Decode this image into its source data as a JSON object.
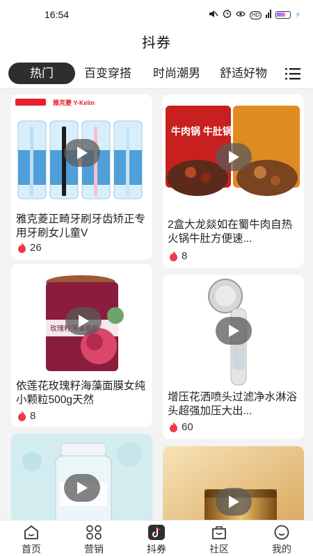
{
  "status_bar": {
    "time": "16:54",
    "icons": [
      "mute-icon",
      "alarm-icon",
      "eye-icon",
      "hd-icon",
      "signal-icon",
      "battery-icon",
      "charging-icon"
    ],
    "hd_text": "HD"
  },
  "header": {
    "title": "抖券"
  },
  "tabs": [
    {
      "label": "热门",
      "active": true
    },
    {
      "label": "百变穿搭"
    },
    {
      "label": "时尚潮男"
    },
    {
      "label": "舒适好物"
    }
  ],
  "products": [
    {
      "title": "雅克菱正畸牙刷牙齿矫正专用牙刷女儿童V",
      "likes": "26",
      "brand_text": "雅克菱 Y-Kelin"
    },
    {
      "title": "2盒大龙燚如在蜀牛肉自热火锅牛肚方便速...",
      "likes": "8",
      "brand_text": "牛肉锅 牛肚锅"
    },
    {
      "title": "依莲花玫瑰籽海藻面膜女纯小颗粒500g天然",
      "likes": "8",
      "brand_text": "玫瑰籽海藻面膜"
    },
    {
      "title": "增压花洒喷头过滤净水淋浴头超强加压大出...",
      "likes": "60"
    },
    {
      "title": "",
      "likes": ""
    },
    {
      "title": "",
      "likes": ""
    }
  ],
  "bottom_nav": [
    {
      "label": "首页",
      "icon": "home-icon"
    },
    {
      "label": "营销",
      "icon": "grid-icon"
    },
    {
      "label": "抖券",
      "icon": "douyin-icon",
      "active": true
    },
    {
      "label": "社区",
      "icon": "community-icon"
    },
    {
      "label": "我的",
      "icon": "profile-icon"
    }
  ],
  "colors": {
    "accent": "#2e2e2e",
    "flame": "#f0384a",
    "background": "#f3f3f3"
  }
}
